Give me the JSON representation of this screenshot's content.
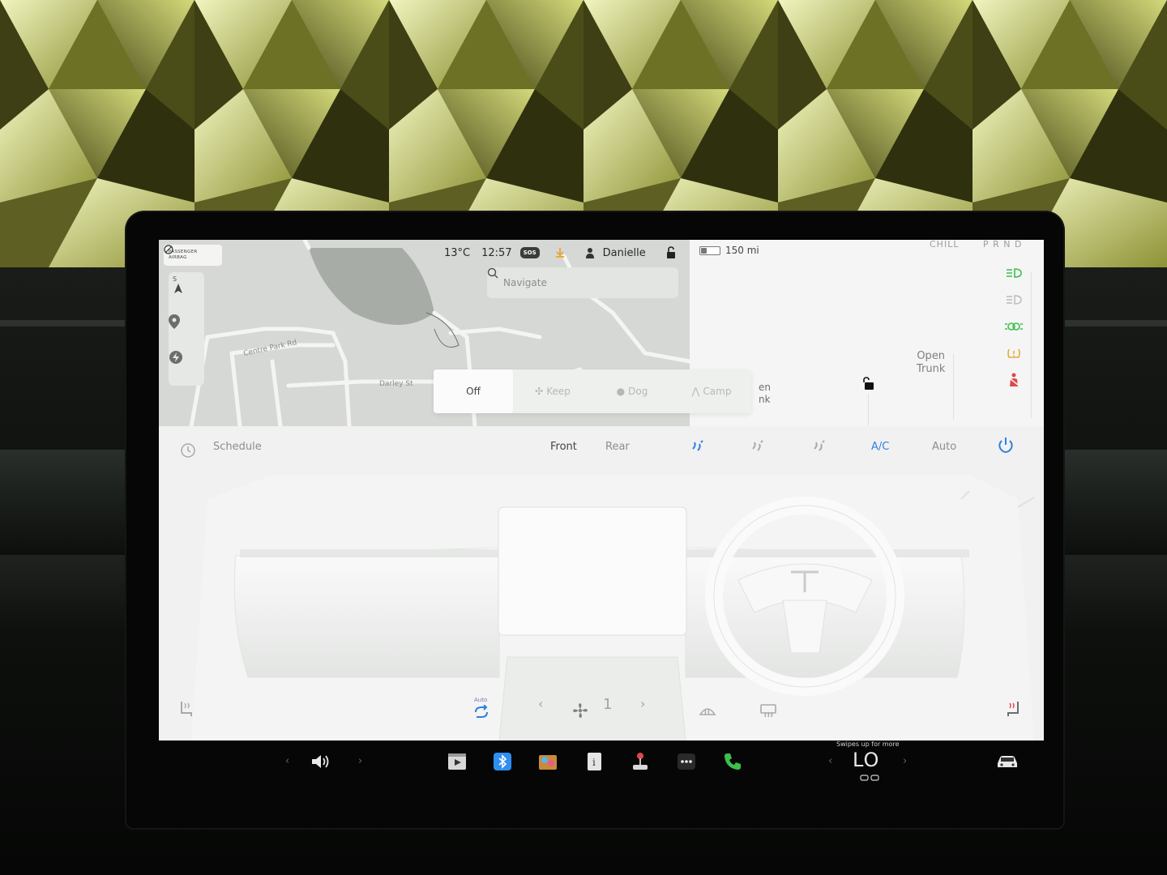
{
  "status_bar": {
    "airbag_line1": "PASSENGER",
    "airbag_line2": "AIRBAG",
    "temperature": "13°C",
    "time": "12:57",
    "sos": "SOS",
    "profile": "Danielle",
    "range": "150 mi",
    "battery_fraction": 0.35,
    "drive_mode": "CHILL",
    "gear": "P R N D"
  },
  "map": {
    "search_placeholder": "Navigate",
    "street1": "Centre Park Rd",
    "street2": "Darley St"
  },
  "car_panel": {
    "trunk_line1": "Open",
    "trunk_line2": "Trunk",
    "frunk_line1": "en",
    "frunk_line2": "nk"
  },
  "climate_keeper": {
    "options": [
      "Off",
      "Keep",
      "Dog",
      "Camp"
    ],
    "selected": "Off"
  },
  "climate": {
    "schedule": "Schedule",
    "front": "Front",
    "rear": "Rear",
    "ac": "A/C",
    "auto": "Auto",
    "recirc_label": "Auto",
    "fan_speed": "1"
  },
  "taskbar": {
    "swipe_hint": "Swipes up for more",
    "temp": "LO"
  },
  "colors": {
    "accent_blue": "#2f7fe0",
    "indicator_green": "#3dbf4f",
    "indicator_amber": "#e8a93a",
    "indicator_red": "#e04848"
  }
}
